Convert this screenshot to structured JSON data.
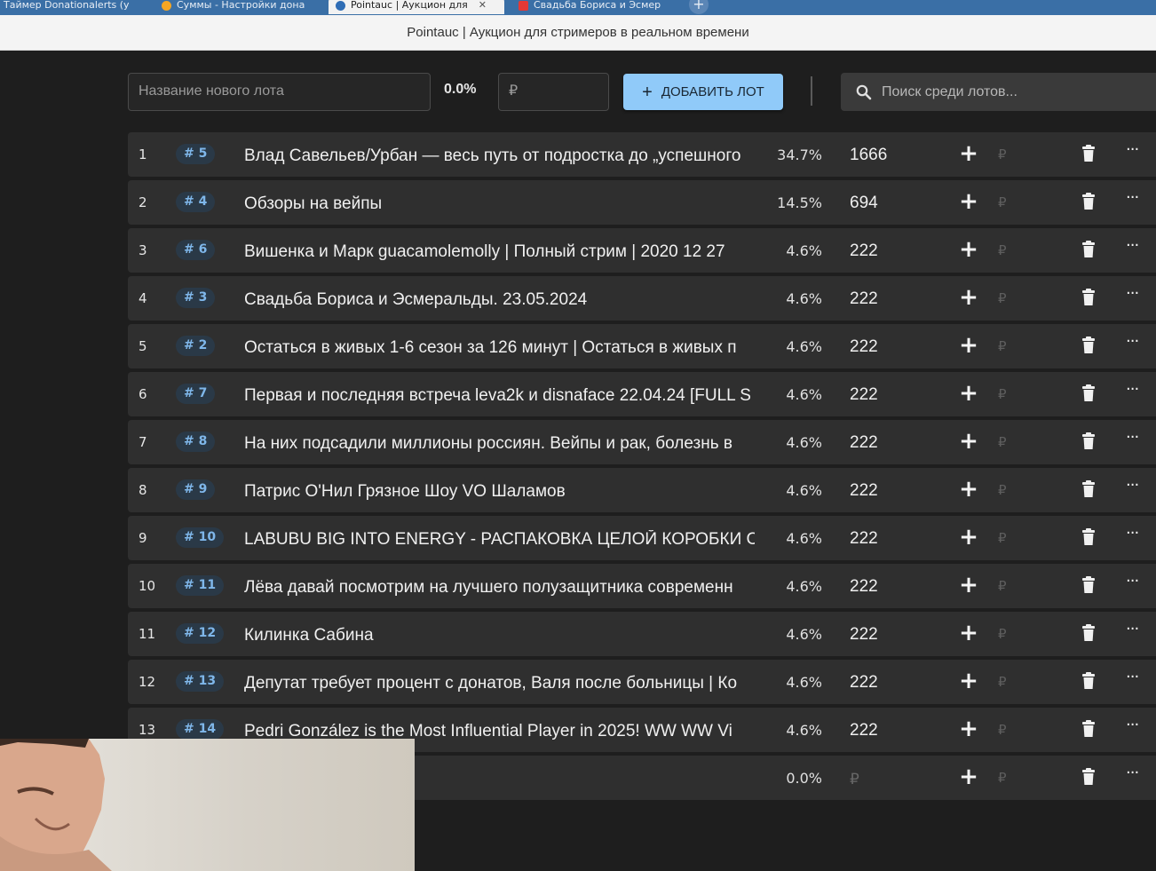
{
  "browser": {
    "tabs": [
      {
        "label": "Таймер Donationalerts (у",
        "color": "#3a6fa6"
      },
      {
        "label": "Суммы - Настройки дона",
        "color": "#f5a623"
      },
      {
        "label": "Pointauc | Аукцион для",
        "color": "#2f6db5",
        "active": true
      },
      {
        "label": "Свадьба Бориса и Эсмер",
        "color": "#e53935"
      }
    ],
    "page_title": "Pointauc | Аукцион для стримеров в реальном времени"
  },
  "toolbar": {
    "new_lot_placeholder": "Название нового лота",
    "percent": "0.0%",
    "amount_placeholder": "₽",
    "add_button_label": "ДОБАВИТЬ ЛОТ",
    "search_placeholder": "Поиск среди лотов..."
  },
  "lots": [
    {
      "n": "1",
      "id": "# 5",
      "name": "Влад Савельев/Урбан — весь путь от подростка до „успешного",
      "pct": "34.7%",
      "amount": "1666"
    },
    {
      "n": "2",
      "id": "# 4",
      "name": "Обзоры на вейпы",
      "pct": "14.5%",
      "amount": "694"
    },
    {
      "n": "3",
      "id": "# 6",
      "name": "Вишенка и Марк guacamolemolly | Полный стрим | 2020 12 27",
      "pct": "4.6%",
      "amount": "222"
    },
    {
      "n": "4",
      "id": "# 3",
      "name": "Свадьба Бориса и Эсмеральды. 23.05.2024",
      "pct": "4.6%",
      "amount": "222"
    },
    {
      "n": "5",
      "id": "# 2",
      "name": "Остаться в живых 1-6 сезон за 126 минут | Остаться в живых п",
      "pct": "4.6%",
      "amount": "222"
    },
    {
      "n": "6",
      "id": "# 7",
      "name": "Первая и последняя встреча leva2k и disnaface 22.04.24 [FULL S",
      "pct": "4.6%",
      "amount": "222"
    },
    {
      "n": "7",
      "id": "# 8",
      "name": "На них подсадили миллионы россиян. Вейпы и рак, болезнь в",
      "pct": "4.6%",
      "amount": "222"
    },
    {
      "n": "8",
      "id": "# 9",
      "name": "Патрис О'Нил Грязное Шоу VO Шаламов",
      "pct": "4.6%",
      "amount": "222"
    },
    {
      "n": "9",
      "id": "# 10",
      "name": "LABUBU BIG INTO ENERGY - РАСПАКОВКА ЦЕЛОЙ КОРОБКИ С.",
      "pct": "4.6%",
      "amount": "222"
    },
    {
      "n": "10",
      "id": "# 11",
      "name": "Лёва давай посмотрим на лучшего полузащитника современн",
      "pct": "4.6%",
      "amount": "222"
    },
    {
      "n": "11",
      "id": "# 12",
      "name": "Килинка Сабина",
      "pct": "4.6%",
      "amount": "222"
    },
    {
      "n": "12",
      "id": "# 13",
      "name": "Депутат требует процент с донатов, Валя после больницы | Ко",
      "pct": "4.6%",
      "amount": "222"
    },
    {
      "n": "13",
      "id": "# 14",
      "name": "Pedri González is the Most Influential Player in 2025! WW WW Vi",
      "pct": "4.6%",
      "amount": "222"
    },
    {
      "n": "",
      "id": "",
      "name": "",
      "pct": "0.0%",
      "amount": "₽",
      "empty": true
    }
  ],
  "row_controls": {
    "plus": "+",
    "rub": "₽",
    "more": "···"
  },
  "icons": [
    "search-icon",
    "plus-icon",
    "trash-icon",
    "more-icon"
  ]
}
